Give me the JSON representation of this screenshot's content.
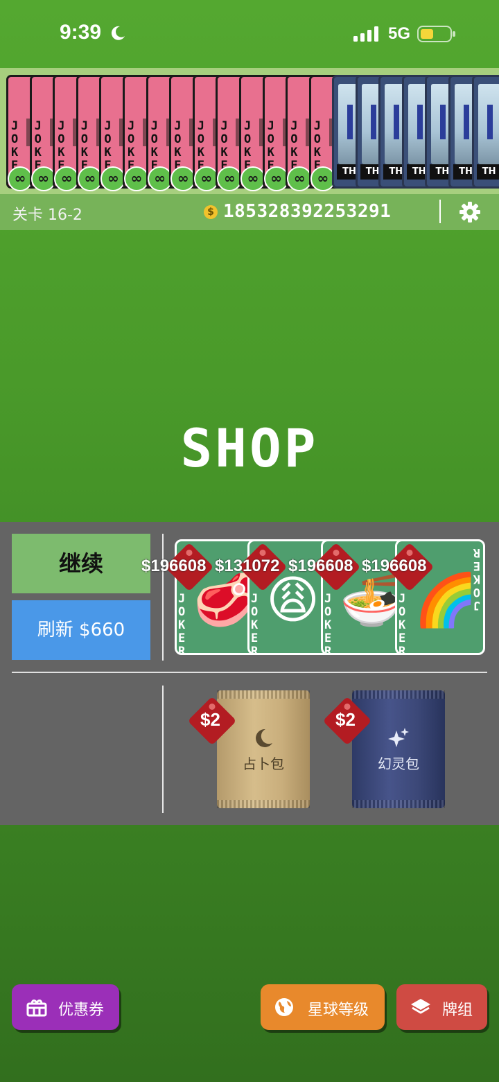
{
  "status_bar": {
    "time": "9:39",
    "network": "5G"
  },
  "jokers": {
    "card_text": "JOKER",
    "edition_symbol": "∞",
    "pink_count": 14,
    "planet_count": 7,
    "planet_label": "TH"
  },
  "info": {
    "level": "关卡 16-2",
    "money_symbol": "$",
    "money": "185328392253291"
  },
  "shop": {
    "title": "SHOP",
    "continue_label": "继续",
    "refresh_label": "刷新 $660",
    "cards": [
      {
        "price": "$196608",
        "emoji": "🥩"
      },
      {
        "price": "$131072",
        "emoji": "😩"
      },
      {
        "price": "$196608",
        "emoji": "🍜"
      },
      {
        "price": "$196608",
        "emoji": "🌈"
      }
    ],
    "card_text": "JOKER",
    "packs": [
      {
        "price": "$2",
        "name": "占卜包",
        "icon": "moon-icon",
        "color": "#c9ae7c"
      },
      {
        "price": "$2",
        "name": "幻灵包",
        "icon": "sparkle-icon",
        "color": "#3c4878"
      }
    ]
  },
  "bottom": {
    "coupon_label": "优惠券",
    "planet_level_label": "星球等级",
    "deck_label": "牌组"
  },
  "colors": {
    "background": "#4a9a2a",
    "joker_card": "#e8708f",
    "continue": "#7dbb6e",
    "refresh": "#4a98e8",
    "shop_panel": "#646464",
    "coupon": "#9b2fb8",
    "planet_level": "#e8892c",
    "deck": "#cf4b43",
    "price_tag": "#b31c22"
  }
}
